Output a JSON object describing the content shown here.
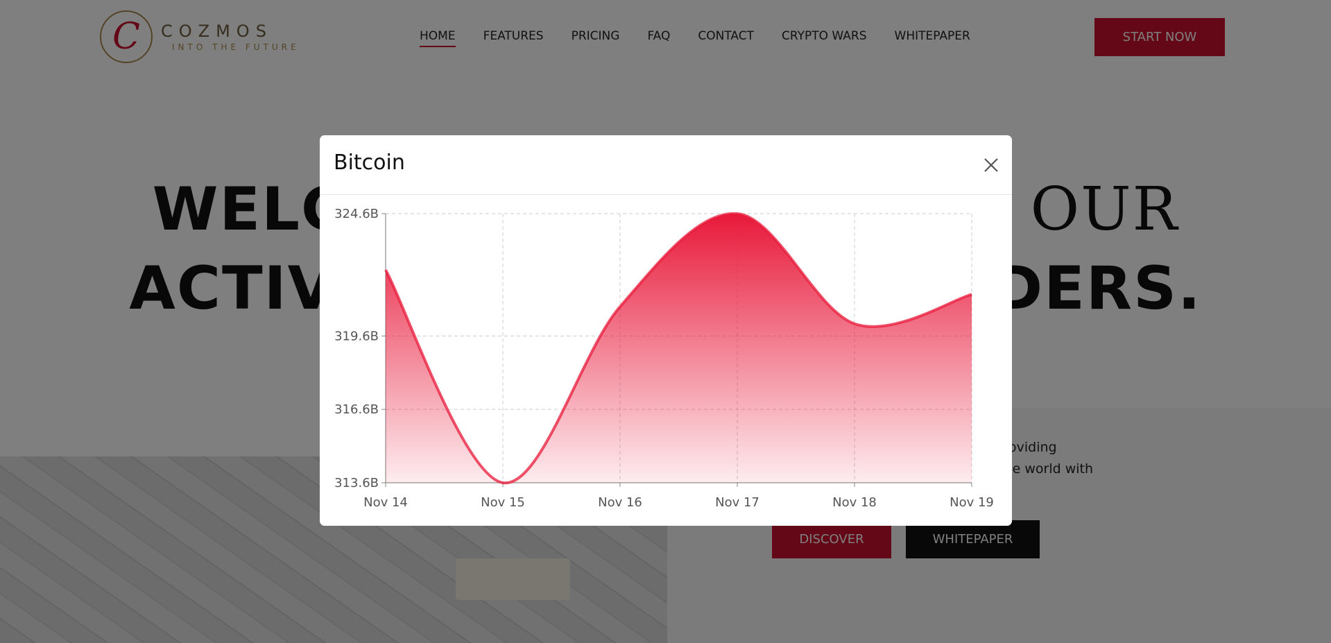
{
  "brand": {
    "logo_letter": "C",
    "name": "COZMOS",
    "tagline": "INTO THE FUTURE"
  },
  "nav": {
    "items": [
      {
        "label": "HOME",
        "active": true
      },
      {
        "label": "FEATURES",
        "active": false
      },
      {
        "label": "PRICING",
        "active": false
      },
      {
        "label": "FAQ",
        "active": false
      },
      {
        "label": "CONTACT",
        "active": false
      },
      {
        "label": "CRYPTO WARS",
        "active": false
      },
      {
        "label": "WHITEPAPER",
        "active": false
      }
    ],
    "cta_label": "START NOW"
  },
  "hero": {
    "line1_left": "WELC",
    "line1_right": "N OUR",
    "line2_left": "ACTIV",
    "line2_right": "ADERS.",
    "description_line1": "m providing",
    "description_line2": "nd the world with",
    "discover_label": "DISCOVER",
    "whitepaper_label": "WHITEPAPER"
  },
  "modal": {
    "title": "Bitcoin"
  },
  "colors": {
    "accent": "#c8102e",
    "dark": "#111111"
  },
  "icons": {
    "close": "close-icon"
  },
  "chart_data": {
    "type": "area",
    "title": "",
    "x": [
      "Nov 14",
      "Nov 15",
      "Nov 16",
      "Nov 17",
      "Nov 18",
      "Nov 19"
    ],
    "series": [
      {
        "values": [
          322.3,
          313.6,
          320.8,
          324.6,
          320.1,
          321.3
        ]
      }
    ],
    "y_ticks": [
      "313.6B",
      "316.6B",
      "319.6B",
      "324.6B"
    ],
    "y_tick_values": [
      313.6,
      316.6,
      319.6,
      324.6
    ],
    "ylim": [
      313.6,
      324.6
    ],
    "grid": true,
    "line_color": "#e8193a"
  }
}
